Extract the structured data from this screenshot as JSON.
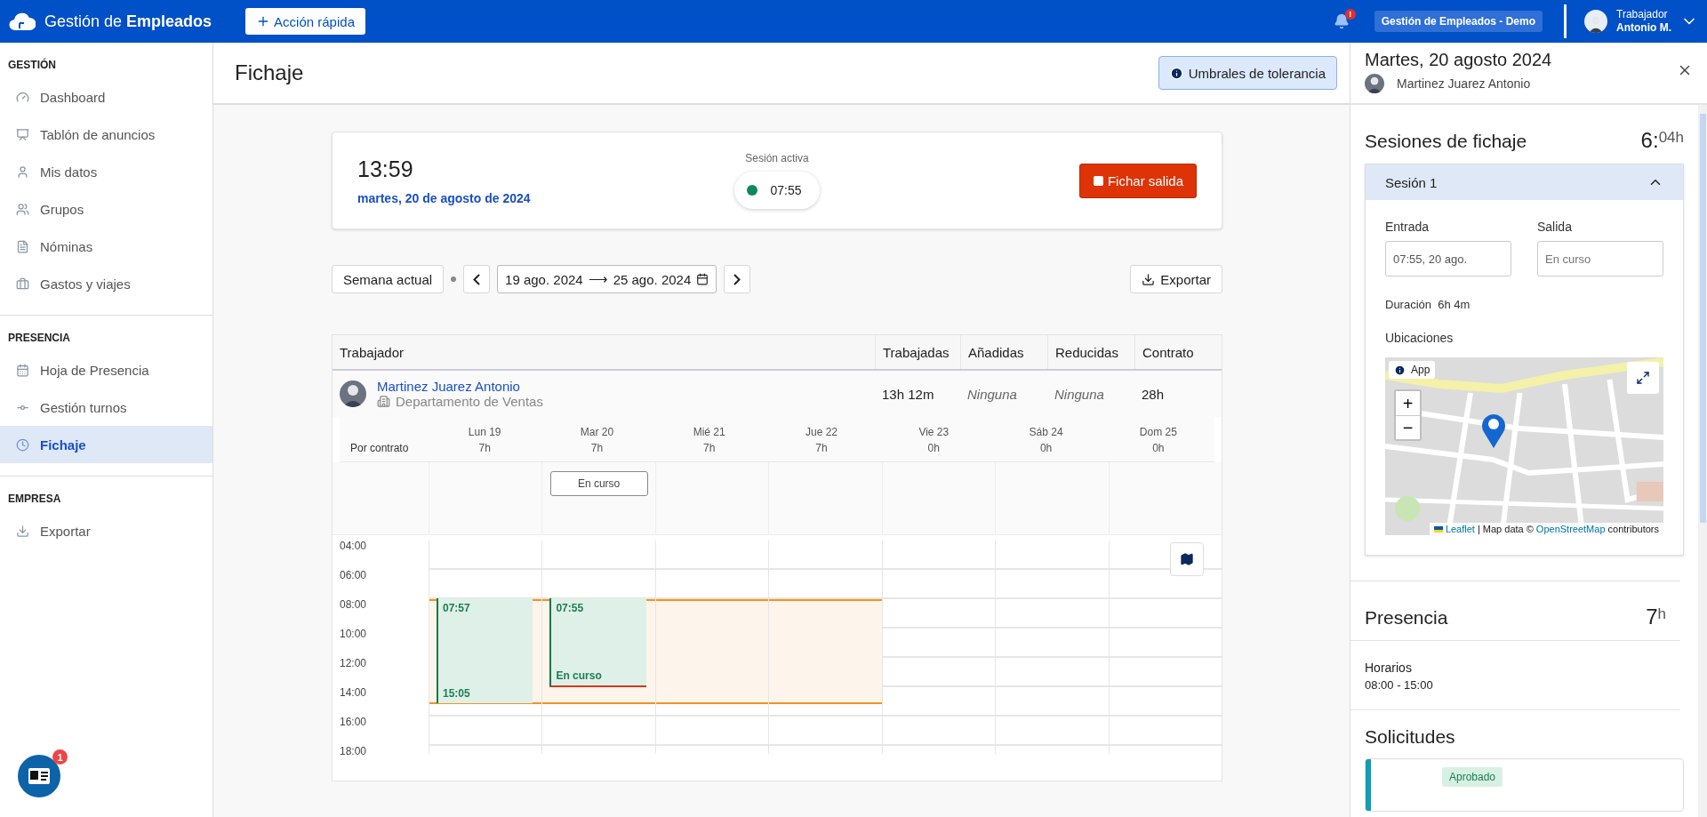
{
  "topbar": {
    "brand_prefix": "Gestión de ",
    "brand_bold": "Empleados",
    "quick_action": "Acción rápida",
    "notification_badge": "!",
    "company": "Gestión de Empleados - Demo",
    "user_role": "Trabajador",
    "user_name": "Antonio M."
  },
  "sidebar": {
    "sections": [
      {
        "title": "GESTIÓN",
        "items": [
          {
            "label": "Dashboard",
            "selected": false
          },
          {
            "label": "Tablón de anuncios",
            "selected": false
          },
          {
            "label": "Mis datos",
            "selected": false
          },
          {
            "label": "Grupos",
            "selected": false
          },
          {
            "label": "Nóminas",
            "selected": false
          },
          {
            "label": "Gastos y viajes",
            "selected": false
          }
        ]
      },
      {
        "title": "PRESENCIA",
        "items": [
          {
            "label": "Hoja de Presencia",
            "selected": false
          },
          {
            "label": "Gestión turnos",
            "selected": false
          },
          {
            "label": "Fichaje",
            "selected": true
          }
        ]
      },
      {
        "title": "EMPRESA",
        "items": [
          {
            "label": "Exportar",
            "selected": false
          }
        ]
      }
    ],
    "chat_badge": "1"
  },
  "page": {
    "title": "Fichaje",
    "tolerance_button": "Umbrales de tolerancia"
  },
  "clock": {
    "time": "13:59",
    "date": "martes, 20 de agosto de 2024",
    "session_label": "Sesión activa",
    "session_start": "07:55",
    "session_active": true,
    "clock_out_button": "Fichar salida"
  },
  "week_controls": {
    "current_week": "Semana actual",
    "range_start": "19 ago. 2024",
    "range_arrow": "⟶",
    "range_end": "25 ago. 2024",
    "export": "Exportar"
  },
  "table": {
    "columns": [
      "Trabajador",
      "Trabajadas",
      "Añadidas",
      "Reducidas",
      "Contrato"
    ],
    "worker": {
      "name": "Martinez Juarez Antonio",
      "department": "Departamento de Ventas",
      "worked": "13h 12m",
      "added": "Ninguna",
      "reduced": "Ninguna",
      "contract": "28h"
    },
    "contract_label": "Por contrato",
    "days": [
      {
        "label": "Lun 19",
        "hours": "7h",
        "scheduled": true,
        "events": [
          {
            "start": "07:57",
            "end": "15:05",
            "kind": "closed"
          }
        ]
      },
      {
        "label": "Mar 20",
        "hours": "7h",
        "scheduled": true,
        "status": "En curso",
        "events": [
          {
            "start": "07:55",
            "end": "En curso",
            "kind": "ongoing"
          }
        ]
      },
      {
        "label": "Mié 21",
        "hours": "7h",
        "scheduled": true
      },
      {
        "label": "Jue 22",
        "hours": "7h",
        "scheduled": true
      },
      {
        "label": "Vie 23",
        "hours": "0h",
        "scheduled": false
      },
      {
        "label": "Sáb 24",
        "hours": "0h",
        "scheduled": false
      },
      {
        "label": "Dom 25",
        "hours": "0h",
        "scheduled": false
      }
    ],
    "time_labels": [
      "04:00",
      "06:00",
      "08:00",
      "10:00",
      "12:00",
      "14:00",
      "16:00",
      "18:00"
    ]
  },
  "detail": {
    "title": "Martes, 20 agosto 2024",
    "worker": "Martinez Juarez Antonio",
    "sessions": {
      "title": "Sesiones de fichaje",
      "total_main": "6:",
      "total_sup": "04h",
      "session": {
        "title": "Sesión 1",
        "expanded": true,
        "entry_label": "Entrada",
        "entry_value": "07:55, 20 ago.",
        "exit_label": "Salida",
        "exit_placeholder": "En curso",
        "duration_label": "Duración",
        "duration": "6h 4m",
        "locations_label": "Ubicaciones",
        "map": {
          "kind": "picture",
          "source_badge": "App",
          "zoom_in": "+",
          "zoom_out": "−",
          "attribution_link": "Leaflet",
          "attribution_text": "| Map data ©",
          "attribution_osm": "OpenStreetMap",
          "attribution_end": "contributors"
        }
      }
    },
    "presence": {
      "title": "Presencia",
      "total": "7",
      "total_sup": "h",
      "schedule_label": "Horarios",
      "schedule": "08:00 - 15:00"
    },
    "requests": {
      "title": "Solicitudes",
      "items": [
        {
          "status": "Aprobado",
          "color": "#0e9fb5"
        }
      ]
    }
  }
}
